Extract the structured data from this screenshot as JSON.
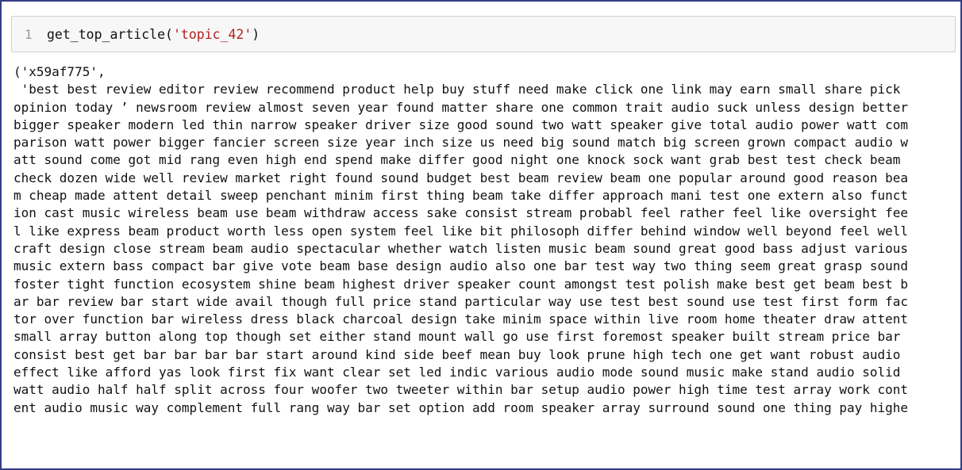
{
  "input_cell": {
    "line_number": "1",
    "code_before": "get_top_article(",
    "code_string": "'topic_42'",
    "code_after": ")"
  },
  "output": {
    "lines": [
      "('x59af775',",
      " 'best best review editor review recommend product help buy stuff need make click one link may earn small share pick",
      "opinion today ’ newsroom review almost seven year found matter share one common trait audio suck unless design better",
      "bigger speaker modern led thin narrow speaker driver size good sound two watt speaker give total audio power watt com",
      "parison watt power bigger fancier screen size year inch size us need big sound match big screen grown compact audio w",
      "att sound come got mid rang even high end spend make differ good night one knock sock want grab best test check beam",
      "check dozen wide well review market right found sound budget best beam review beam one popular around good reason bea",
      "m cheap made attent detail sweep penchant minim first thing beam take differ approach mani test one extern also funct",
      "ion cast music wireless beam use beam withdraw access sake consist stream probabl feel rather feel like oversight fee",
      "l like express beam product worth less open system feel like bit philosoph differ behind window well beyond feel well",
      "craft design close stream beam audio spectacular whether watch listen music beam sound great good bass adjust various",
      "music extern bass compact bar give vote beam base design audio also one bar test way two thing seem great grasp sound",
      "foster tight function ecosystem shine beam highest driver speaker count amongst test polish make best get beam best b",
      "ar bar review bar start wide avail though full price stand particular way use test best sound use test first form fac",
      "tor over function bar wireless dress black charcoal design take minim space within live room home theater draw attent",
      "small array button along top though set either stand mount wall go use first foremost speaker built stream price bar",
      "consist best get bar bar bar bar start around kind side beef mean buy look prune high tech one get want robust audio",
      "effect like afford yas look first fix want clear set led indic various audio mode sound music make stand audio solid",
      "watt audio half half split across four woofer two tweeter within bar setup audio power high time test array work cont",
      "ent audio music way complement full rang way bar set option add room speaker array surround sound one thing pay highe"
    ]
  }
}
